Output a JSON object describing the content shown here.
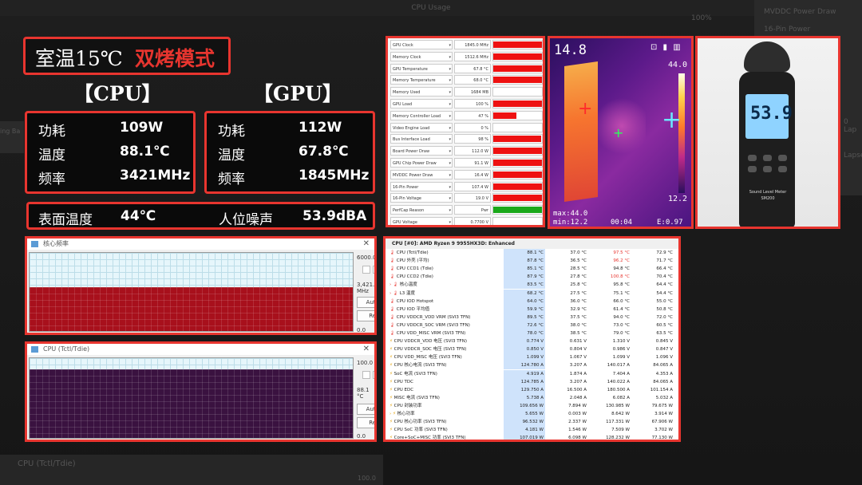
{
  "background": {
    "window_title": "CPU Usage",
    "percent_label": "100%",
    "right_items": [
      "MVDDC Power Draw",
      "16-Pin Power"
    ],
    "right_side_texts": [
      "0 Lap",
      "Lapse"
    ],
    "left_side_text": "ing Ba",
    "bottom_window_title": "CPU (Tctl/Tdie)",
    "bottom_window_value": "100.0"
  },
  "title": {
    "room_temp": "室温15℃",
    "mode": "双烤模式"
  },
  "cpu": {
    "header": "【CPU】",
    "rows": [
      {
        "label": "功耗",
        "value": "109W"
      },
      {
        "label": "温度",
        "value": "88.1℃"
      },
      {
        "label": "频率",
        "value": "3421MHz"
      }
    ]
  },
  "gpu": {
    "header": "【GPU】",
    "rows": [
      {
        "label": "功耗",
        "value": "112W"
      },
      {
        "label": "温度",
        "value": "67.8℃"
      },
      {
        "label": "频率",
        "value": "1845MHz"
      }
    ]
  },
  "surface": {
    "label": "表面温度",
    "value": "44℃",
    "noise_label": "人位噪声",
    "noise_value": "53.9dBA"
  },
  "gpuz": [
    {
      "label": "GPU Clock",
      "value": "1845.0 MHz",
      "fill": 1.0,
      "color": "#ee1111"
    },
    {
      "label": "Memory Clock",
      "value": "1512.6 MHz",
      "fill": 1.0,
      "color": "#ee1111"
    },
    {
      "label": "GPU Temperature",
      "value": "67.8 °C",
      "fill": 1.0,
      "color": "#ee1111"
    },
    {
      "label": "Memory Temperature",
      "value": "68.0 °C",
      "fill": 1.0,
      "color": "#ee1111"
    },
    {
      "label": "Memory Used",
      "value": "1684 MB",
      "fill": 0.0,
      "color": "#ee1111"
    },
    {
      "label": "GPU Load",
      "value": "100 %",
      "fill": 1.0,
      "color": "#ee1111"
    },
    {
      "label": "Memory Controller Load",
      "value": "47 %",
      "fill": 0.47,
      "color": "#ee1111"
    },
    {
      "label": "Video Engine Load",
      "value": "0 %",
      "fill": 0.0,
      "color": "#ee1111"
    },
    {
      "label": "Bus Interface Load",
      "value": "98 %",
      "fill": 0.98,
      "color": "#ee1111"
    },
    {
      "label": "Board Power Draw",
      "value": "112.0 W",
      "fill": 1.0,
      "color": "#ee1111"
    },
    {
      "label": "GPU Chip Power Draw",
      "value": "91.1 W",
      "fill": 1.0,
      "color": "#ee1111"
    },
    {
      "label": "MVDDC Power Draw",
      "value": "16.4 W",
      "fill": 1.0,
      "color": "#ee1111"
    },
    {
      "label": "16-Pin Power",
      "value": "107.4 W",
      "fill": 1.0,
      "color": "#ee1111"
    },
    {
      "label": "16-Pin Voltage",
      "value": "19.0 V",
      "fill": 1.0,
      "color": "#ee1111"
    },
    {
      "label": "PerfCap Reason",
      "value": "Pwr",
      "fill": 1.0,
      "color": "#1aa81a"
    },
    {
      "label": "GPU Voltage",
      "value": "0.7700 V",
      "fill": 0.0,
      "color": "#ee1111"
    }
  ],
  "thermal": {
    "top_value": "14.8",
    "scale_max": "44.0",
    "scale_min": "12.2",
    "max_line": "max:44.0",
    "min_line": "min:12.2",
    "time": "00:04",
    "emissivity": "E:0.97",
    "icons": "⊡ ▮ ▥"
  },
  "meter": {
    "reading": "53.9",
    "brand": "Sound Level Meter",
    "model": "SM200"
  },
  "core_window": {
    "title": "核心频率",
    "max_label": "6000.0",
    "current": "3,421.3 MHz",
    "min_label": "0.0",
    "autofit": "Auto Fit",
    "reset": "Reset",
    "fill_fraction": 0.57,
    "fill_color": "#a8101c"
  },
  "temp_window": {
    "title": "CPU (Tctl/Tdie)",
    "max_label": "100.0",
    "current": "88.1 °C",
    "min_label": "0.0",
    "autofit": "Auto Fit",
    "reset": "Reset",
    "fill_fraction": 0.88,
    "fill_color": "#3a1240"
  },
  "hwinfo": {
    "header": "CPU [#0]: AMD Ryzen 9 9955HX3D: Enhanced",
    "rows": [
      {
        "icon": "🌡",
        "name": "CPU (Tctl/Tdie)",
        "v1": "88.1 °C",
        "v2": "37.0 °C",
        "v3": "97.5 °C",
        "v4": "72.9 °C",
        "hot": true
      },
      {
        "icon": "🌡",
        "name": "CPU 外壳 (平均)",
        "v1": "87.8 °C",
        "v2": "36.5 °C",
        "v3": "96.2 °C",
        "v4": "71.7 °C",
        "hot": true
      },
      {
        "icon": "🌡",
        "name": "CPU CCD1 (Tdie)",
        "v1": "85.1 °C",
        "v2": "28.5 °C",
        "v3": "94.8 °C",
        "v4": "66.4 °C",
        "hot": false
      },
      {
        "icon": "🌡",
        "name": "CPU CCD2 (Tdie)",
        "v1": "87.9 °C",
        "v2": "27.8 °C",
        "v3": "100.8 °C",
        "v4": "70.4 °C",
        "hot": true
      },
      {
        "icon": "› 🌡",
        "name": "核心温度",
        "v1": "83.5 °C",
        "v2": "25.8 °C",
        "v3": "95.8 °C",
        "v4": "64.4 °C",
        "hot": false
      },
      {
        "icon": "› 🌡",
        "name": "L3 温度",
        "v1": "68.2 °C",
        "v2": "27.5 °C",
        "v3": "75.1 °C",
        "v4": "54.4 °C",
        "hot": false
      },
      {
        "icon": "🌡",
        "name": "CPU IOD Hotspot",
        "v1": "64.0 °C",
        "v2": "36.0 °C",
        "v3": "66.0 °C",
        "v4": "55.0 °C",
        "hot": false
      },
      {
        "icon": "🌡",
        "name": "CPU IOD 平均值",
        "v1": "59.9 °C",
        "v2": "32.9 °C",
        "v3": "61.4 °C",
        "v4": "50.8 °C",
        "hot": false
      },
      {
        "icon": "🌡",
        "name": "CPU VDDCR_VDD VRM (SVI3 TFN)",
        "v1": "89.5 °C",
        "v2": "37.5 °C",
        "v3": "94.0 °C",
        "v4": "72.0 °C",
        "hot": false
      },
      {
        "icon": "🌡",
        "name": "CPU VDDCR_SOC VRM (SVI3 TFN)",
        "v1": "72.6 °C",
        "v2": "38.0 °C",
        "v3": "73.0 °C",
        "v4": "60.5 °C",
        "hot": false
      },
      {
        "icon": "🌡",
        "name": "CPU VDD_MISC VRM (SVI3 TFN)",
        "v1": "78.0 °C",
        "v2": "38.5 °C",
        "v3": "79.0 °C",
        "v4": "63.5 °C",
        "hot": false
      },
      {
        "icon": "⚡",
        "name": "CPU VDDCR_VDD 电压 (SVI3 TFN)",
        "v1": "0.774 V",
        "v2": "0.631 V",
        "v3": "1.310 V",
        "v4": "0.845 V",
        "hot": false
      },
      {
        "icon": "⚡",
        "name": "CPU VDDCR_SOC 电压 (SVI3 TFN)",
        "v1": "0.850 V",
        "v2": "0.804 V",
        "v3": "0.986 V",
        "v4": "0.847 V",
        "hot": false
      },
      {
        "icon": "⚡",
        "name": "CPU VDD_MISC 电压 (SVI3 TFN)",
        "v1": "1.099 V",
        "v2": "1.067 V",
        "v3": "1.099 V",
        "v4": "1.096 V",
        "hot": false
      },
      {
        "icon": "⚡",
        "name": "CPU 核心电流 (SVI3 TFN)",
        "v1": "124.780 A",
        "v2": "3.207 A",
        "v3": "140.017 A",
        "v4": "84.065 A",
        "hot": false
      },
      {
        "icon": "⚡",
        "name": "SoC 电流 (SVI3 TFN)",
        "v1": "4.919 A",
        "v2": "1.874 A",
        "v3": "7.404 A",
        "v4": "4.353 A",
        "hot": false
      },
      {
        "icon": "⚡",
        "name": "CPU TDC",
        "v1": "124.785 A",
        "v2": "3.207 A",
        "v3": "140.022 A",
        "v4": "84.065 A",
        "hot": false
      },
      {
        "icon": "⚡",
        "name": "CPU EDC",
        "v1": "129.750 A",
        "v2": "16.500 A",
        "v3": "180.500 A",
        "v4": "101.154 A",
        "hot": false
      },
      {
        "icon": "⚡",
        "name": "MISC 电流 (SVI3 TFN)",
        "v1": "5.738 A",
        "v2": "2.048 A",
        "v3": "6.082 A",
        "v4": "5.032 A",
        "hot": false
      },
      {
        "icon": "⚡",
        "name": "CPU 封装功率",
        "v1": "109.656 W",
        "v2": "7.894 W",
        "v3": "130.985 W",
        "v4": "79.675 W",
        "hot": false
      },
      {
        "icon": "› ⚡",
        "name": "核心功率",
        "v1": "5.655 W",
        "v2": "0.003 W",
        "v3": "8.642 W",
        "v4": "3.914 W",
        "hot": false
      },
      {
        "icon": "⚡",
        "name": "CPU 核心功率 (SVI3 TFN)",
        "v1": "96.532 W",
        "v2": "2.337 W",
        "v3": "117.331 W",
        "v4": "67.906 W",
        "hot": false
      },
      {
        "icon": "⚡",
        "name": "CPU SoC 功率 (SVI3 TFN)",
        "v1": "4.181 W",
        "v2": "1.546 W",
        "v3": "7.509 W",
        "v4": "3.702 W",
        "hot": false
      },
      {
        "icon": "⚡",
        "name": "Core+SoC+MISC 功率 (SVI3 TFN)",
        "v1": "107.019 W",
        "v2": "6.098 W",
        "v3": "128.232 W",
        "v4": "77.130 W",
        "hot": false
      }
    ]
  }
}
